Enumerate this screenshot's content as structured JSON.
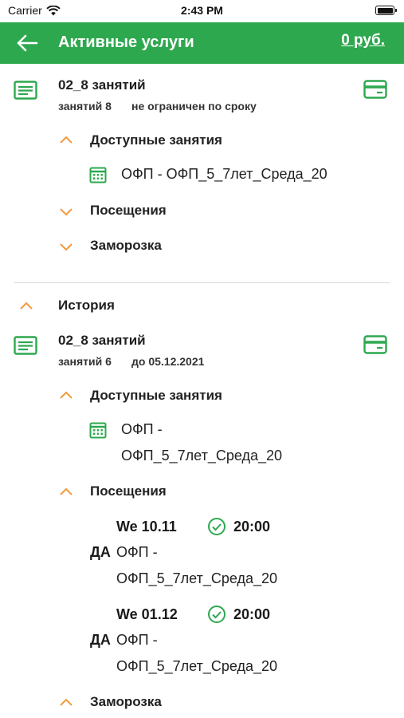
{
  "status_bar": {
    "carrier": "Carrier",
    "time": "2:43 PM"
  },
  "header": {
    "title": "Активные услуги",
    "balance": "0 руб."
  },
  "colors": {
    "primary": "#2ea84f",
    "accent_orange": "#f29a3a",
    "icon_green": "#2ea84f"
  },
  "active_service": {
    "title": "02_8 занятий",
    "lessons": "занятий 8",
    "validity": "не ограничен по сроку",
    "available_label": "Доступные занятия",
    "available_items": [
      "ОФП - ОФП_5_7лет_Среда_20"
    ],
    "visits_label": "Посещения",
    "freeze_label": "Заморозка"
  },
  "history": {
    "label": "История",
    "service": {
      "title": "02_8 занятий",
      "lessons": "занятий 6",
      "validity": "до 05.12.2021",
      "available_label": "Доступные занятия",
      "available_item_line1": "ОФП -",
      "available_item_line2": "ОФП_5_7лет_Среда_20",
      "visits_label": "Посещения",
      "visits": [
        {
          "date": "We 10.11",
          "time": "20:00",
          "status": "ДА",
          "name_line1": "ОФП -",
          "name_line2": "ОФП_5_7лет_Среда_20"
        },
        {
          "date": "We 01.12",
          "time": "20:00",
          "status": "ДА",
          "name_line1": "ОФП -",
          "name_line2": "ОФП_5_7лет_Среда_20"
        }
      ],
      "freeze_label": "Заморозка"
    }
  }
}
